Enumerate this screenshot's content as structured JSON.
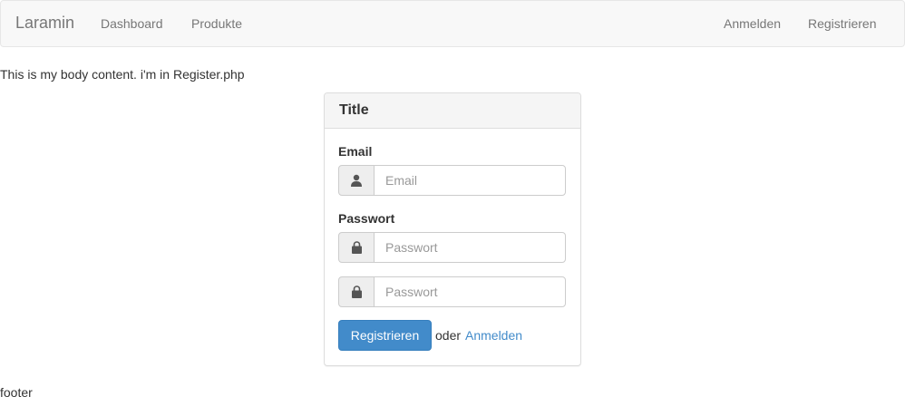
{
  "navbar": {
    "brand": "Laramin",
    "left_links": [
      "Dashboard",
      "Produkte"
    ],
    "right_links": [
      "Anmelden",
      "Registrieren"
    ]
  },
  "body_text": "This is my body content. i'm in Register.php",
  "panel": {
    "title": "Title",
    "email_label": "Email",
    "email_placeholder": "Email",
    "email_icon": "user-icon",
    "password_label": "Passwort",
    "password_placeholder": "Passwort",
    "password_confirm_placeholder": "Passwort",
    "password_icon": "lock-icon",
    "submit_label": "Registrieren",
    "or_text": "oder",
    "login_link": "Anmelden"
  },
  "footer": "footer",
  "colors": {
    "primary": "#428bca",
    "navbar_bg": "#f8f8f8",
    "link": "#428bca"
  }
}
